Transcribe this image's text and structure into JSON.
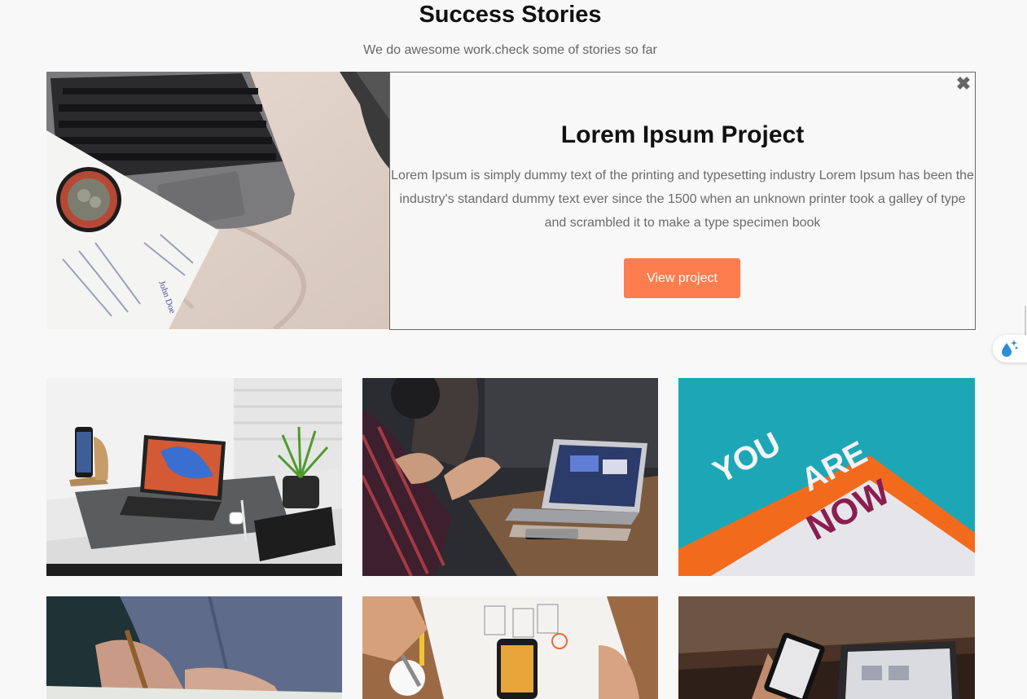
{
  "section": {
    "title": "Success Stories",
    "subtitle": "We do awesome work.check some of stories so far"
  },
  "featured": {
    "title": "Lorem Ipsum Project",
    "description": "Lorem Ipsum is simply dummy text of the printing and typesetting industry Lorem Ipsum has been the industry's standard dummy text ever since the 1500 when an unknown printer took a galley of type and scrambled it to make a type specimen book",
    "button_label": "View project",
    "close_glyph": "✖",
    "image_signature": "John Doe",
    "image_icon": "laptop-resume-photo"
  },
  "colors": {
    "accent": "#fd7d4e",
    "background": "#f8f8f8"
  },
  "grid": {
    "items": [
      {
        "icon": "ipad-desk-photo"
      },
      {
        "icon": "laptop-meeting-photo"
      },
      {
        "icon": "you-are-now-photo",
        "text": "YOU ARE NOW"
      },
      {
        "icon": "writing-hand-photo"
      },
      {
        "icon": "smartphone-sketches-photo"
      },
      {
        "icon": "phone-laptop-photo"
      }
    ]
  },
  "widget": {
    "icon": "water-drop-sparkle-icon"
  }
}
